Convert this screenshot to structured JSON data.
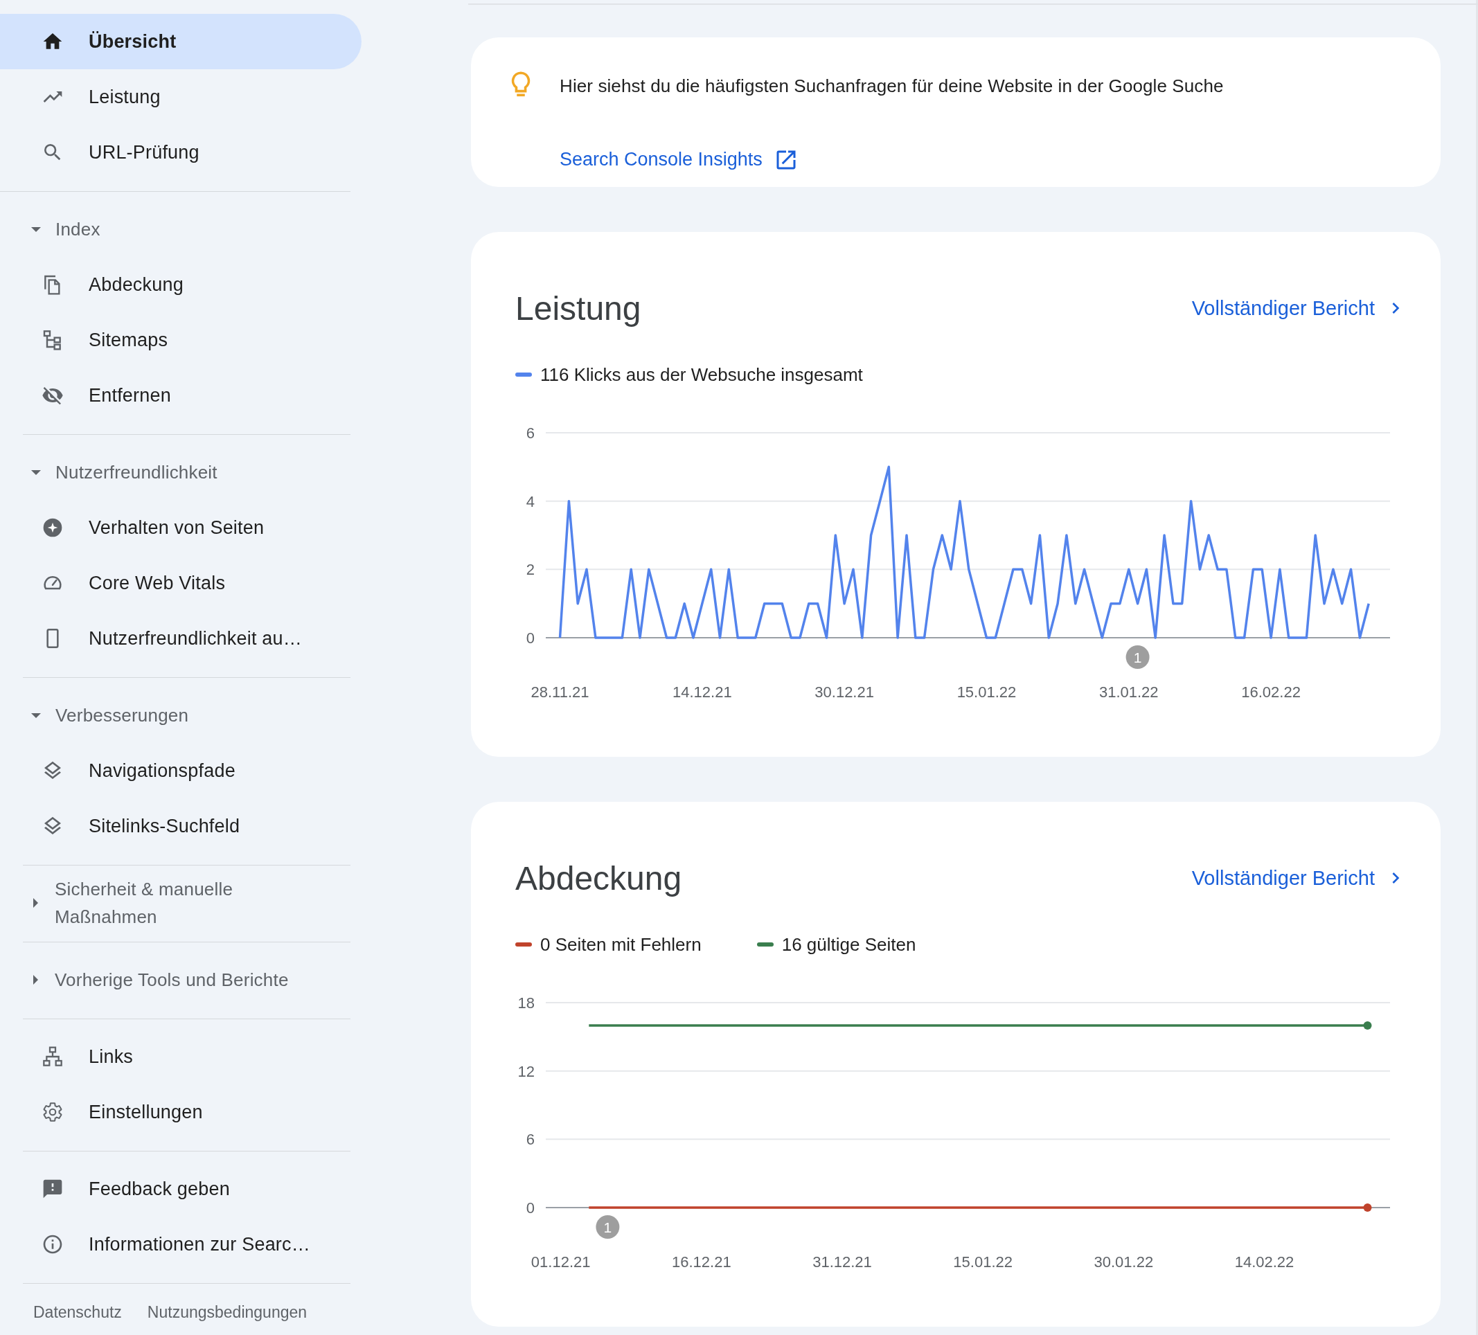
{
  "sidebar": {
    "groups": [
      {
        "items": [
          {
            "label": "Übersicht",
            "selected": true
          },
          {
            "label": "Leistung",
            "selected": false
          },
          {
            "label": "URL-Prüfung",
            "selected": false
          }
        ]
      },
      {
        "header": "Index",
        "expanded": true,
        "items": [
          {
            "label": "Abdeckung",
            "selected": false
          },
          {
            "label": "Sitemaps",
            "selected": false
          },
          {
            "label": "Entfernen",
            "selected": false
          }
        ]
      },
      {
        "header": "Nutzerfreundlichkeit",
        "expanded": true,
        "items": [
          {
            "label": "Verhalten von Seiten",
            "selected": false
          },
          {
            "label": "Core Web Vitals",
            "selected": false
          },
          {
            "label": "Nutzerfreundlichkeit au…",
            "selected": false
          }
        ]
      },
      {
        "header": "Verbesserungen",
        "expanded": true,
        "items": [
          {
            "label": "Navigationspfade",
            "selected": false
          },
          {
            "label": "Sitelinks-Suchfeld",
            "selected": false
          }
        ]
      },
      {
        "header": "Sicherheit & manuelle\nMaßnahmen",
        "expanded": false
      },
      {
        "header": "Vorherige Tools und Berichte",
        "expanded": false
      },
      {
        "items": [
          {
            "label": "Links",
            "selected": false
          },
          {
            "label": "Einstellungen",
            "selected": false
          }
        ]
      },
      {
        "items": [
          {
            "label": "Feedback geben",
            "selected": false
          },
          {
            "label": "Informationen zur Searc…",
            "selected": false
          }
        ]
      }
    ],
    "footer_links": [
      "Datenschutz",
      "Nutzungsbedingungen"
    ]
  },
  "insight": {
    "text": "Hier siehst du die häufigsten Suchanfragen für deine Website in der Google Suche",
    "link": "Search Console Insights"
  },
  "cards": [
    {
      "title": "Leistung",
      "link": "Vollständiger Bericht",
      "chart_data": {
        "type": "line",
        "ylim": [
          0,
          6
        ],
        "yticks": [
          0,
          2,
          4,
          6
        ],
        "categories": [
          "28.11.21",
          null,
          null,
          null,
          null,
          null,
          null,
          null,
          null,
          null,
          null,
          null,
          null,
          null,
          null,
          null,
          "14.12.21",
          null,
          null,
          null,
          null,
          null,
          null,
          null,
          null,
          null,
          null,
          null,
          null,
          null,
          null,
          null,
          "30.12.21",
          null,
          null,
          null,
          null,
          null,
          null,
          null,
          null,
          null,
          null,
          null,
          null,
          null,
          null,
          null,
          "15.01.22",
          null,
          null,
          null,
          null,
          null,
          null,
          null,
          null,
          null,
          null,
          null,
          null,
          null,
          null,
          null,
          "31.01.22",
          null,
          null,
          null,
          null,
          null,
          null,
          null,
          null,
          null,
          null,
          null,
          null,
          null,
          null,
          null,
          "16.02.22",
          null,
          null,
          null,
          null,
          null,
          null,
          null,
          null,
          null,
          null,
          null
        ],
        "series": [
          {
            "name": "116 Klicks aus der Websuche insgesamt",
            "color": "#5383ec",
            "values": [
              0,
              4,
              1,
              2,
              0,
              0,
              0,
              0,
              2,
              0,
              2,
              1,
              0,
              0,
              1,
              0,
              1,
              2,
              0,
              2,
              0,
              0,
              0,
              1,
              1,
              1,
              0,
              0,
              1,
              1,
              0,
              3,
              1,
              2,
              0,
              3,
              4,
              5,
              0,
              3,
              0,
              0,
              2,
              3,
              2,
              4,
              2,
              1,
              0,
              0,
              1,
              2,
              2,
              1,
              3,
              0,
              1,
              3,
              1,
              2,
              1,
              0,
              1,
              1,
              2,
              1,
              2,
              0,
              3,
              1,
              1,
              4,
              2,
              3,
              2,
              2,
              0,
              0,
              2,
              2,
              0,
              2,
              0,
              0,
              0,
              3,
              1,
              2,
              1,
              2,
              0,
              1
            ]
          }
        ],
        "annotations": [
          "1"
        ]
      }
    },
    {
      "title": "Abdeckung",
      "link": "Vollständiger Bericht",
      "chart_data": {
        "type": "line",
        "ylim": [
          0,
          18
        ],
        "yticks": [
          0,
          6,
          12,
          18
        ],
        "categories": [
          "01.12.21",
          null,
          null,
          null,
          null,
          null,
          null,
          null,
          null,
          null,
          null,
          null,
          null,
          null,
          null,
          "16.12.21",
          null,
          null,
          null,
          null,
          null,
          null,
          null,
          null,
          null,
          null,
          null,
          null,
          null,
          null,
          "31.12.21",
          null,
          null,
          null,
          null,
          null,
          null,
          null,
          null,
          null,
          null,
          null,
          null,
          null,
          null,
          "15.01.22",
          null,
          null,
          null,
          null,
          null,
          null,
          null,
          null,
          null,
          null,
          null,
          null,
          null,
          null,
          "30.01.22",
          null,
          null,
          null,
          null,
          null,
          null,
          null,
          null,
          null,
          null,
          null,
          null,
          null,
          null,
          "14.02.22",
          null,
          null,
          null,
          null,
          null,
          null,
          null,
          null,
          null,
          null,
          null
        ],
        "series": [
          {
            "name": "0 Seiten mit Fehlern",
            "color": "#c0432c",
            "values": [
              null,
              null,
              null,
              0,
              0,
              0,
              0,
              0,
              0,
              0,
              0,
              0,
              0,
              0,
              0,
              0,
              0,
              0,
              0,
              0,
              0,
              0,
              0,
              0,
              0,
              0,
              0,
              0,
              0,
              0,
              0,
              0,
              0,
              0,
              0,
              0,
              0,
              0,
              0,
              0,
              0,
              0,
              0,
              0,
              0,
              0,
              0,
              0,
              0,
              0,
              0,
              0,
              0,
              0,
              0,
              0,
              0,
              0,
              0,
              0,
              0,
              0,
              0,
              0,
              0,
              0,
              0,
              0,
              0,
              0,
              0,
              0,
              0,
              0,
              0,
              0,
              0,
              0,
              0,
              0,
              0,
              0,
              0,
              0,
              0,
              0,
              0
            ]
          },
          {
            "name": "16 gültige Seiten",
            "color": "#3a7e4e",
            "values": [
              null,
              null,
              null,
              16,
              16,
              16,
              16,
              16,
              16,
              16,
              16,
              16,
              16,
              16,
              16,
              16,
              16,
              16,
              16,
              16,
              16,
              16,
              16,
              16,
              16,
              16,
              16,
              16,
              16,
              16,
              16,
              16,
              16,
              16,
              16,
              16,
              16,
              16,
              16,
              16,
              16,
              16,
              16,
              16,
              16,
              16,
              16,
              16,
              16,
              16,
              16,
              16,
              16,
              16,
              16,
              16,
              16,
              16,
              16,
              16,
              16,
              16,
              16,
              16,
              16,
              16,
              16,
              16,
              16,
              16,
              16,
              16,
              16,
              16,
              16,
              16,
              16,
              16,
              16,
              16,
              16,
              16,
              16,
              16,
              16,
              16,
              16
            ]
          }
        ],
        "annotations": [
          "1"
        ]
      }
    }
  ]
}
